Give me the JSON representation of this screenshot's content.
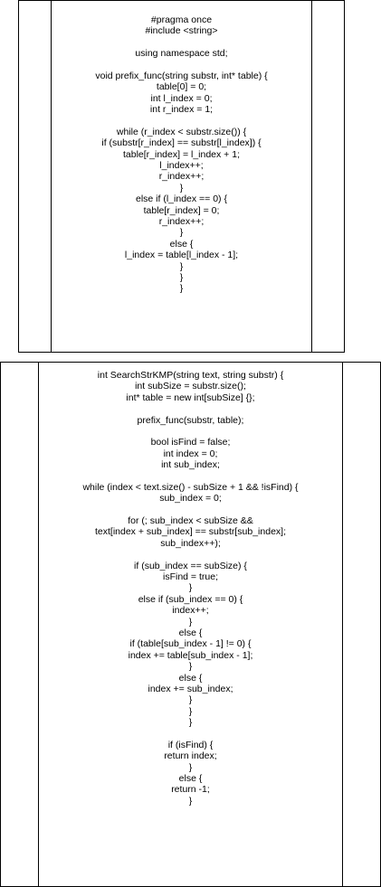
{
  "block1": {
    "lines": [
      "#pragma once",
      "#include <string>",
      "",
      "using namespace std;",
      "",
      "void prefix_func(string substr, int* table) {",
      "table[0] = 0;",
      "int l_index = 0;",
      "int r_index = 1;",
      "",
      "while (r_index < substr.size()) {",
      "if (substr[r_index] == substr[l_index]) {",
      "table[r_index] = l_index + 1;",
      "l_index++;",
      "r_index++;",
      "}",
      "else if (l_index == 0) {",
      "table[r_index] = 0;",
      "r_index++;",
      "}",
      "else {",
      "l_index = table[l_index - 1];",
      "}",
      "}",
      "}"
    ]
  },
  "block2": {
    "lines": [
      "int SearchStrKMP(string text, string substr) {",
      "int subSize = substr.size();",
      "int* table = new int[subSize] {};",
      "",
      "prefix_func(substr, table);",
      "",
      "bool isFind = false;",
      "int index = 0;",
      "int sub_index;",
      "",
      "while (index < text.size() - subSize + 1 && !isFind) {",
      "sub_index = 0;",
      "",
      "for (; sub_index < subSize &&",
      "text[index + sub_index] == substr[sub_index];",
      "sub_index++);",
      "",
      "if (sub_index == subSize) {",
      "isFind = true;",
      "}",
      "else if (sub_index == 0) {",
      "index++;",
      "}",
      "else {",
      "if (table[sub_index - 1] != 0) {",
      "index += table[sub_index - 1];",
      "}",
      "else {",
      "index += sub_index;",
      "}",
      "}",
      "}",
      "",
      "if (isFind) {",
      "return index;",
      "}",
      "else {",
      "return -1;",
      "}"
    ]
  }
}
